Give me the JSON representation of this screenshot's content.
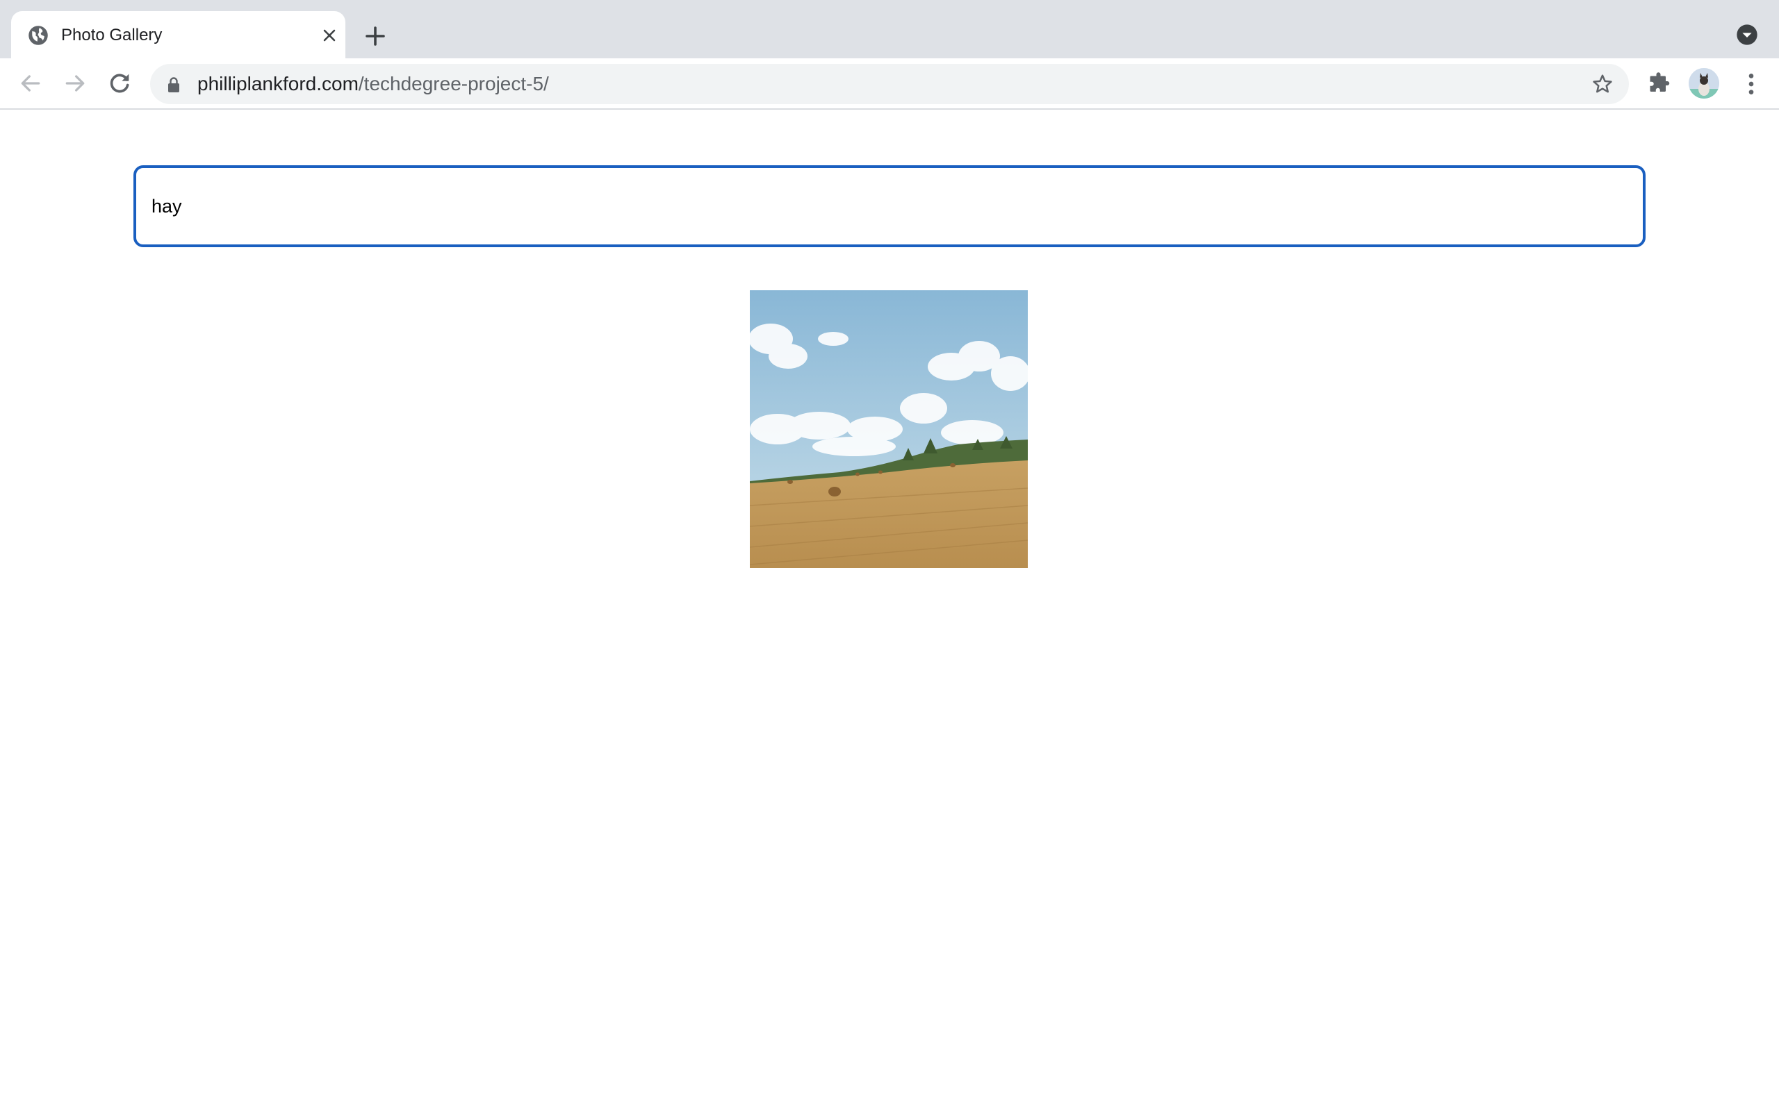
{
  "browser": {
    "tab": {
      "title": "Photo Gallery",
      "favicon": "globe-icon"
    },
    "toolbar": {
      "url_host": "philliplankford.com",
      "url_path": "/techdegree-project-5/",
      "icons": [
        "back-arrow-icon",
        "forward-arrow-icon",
        "reload-icon",
        "lock-icon",
        "star-icon",
        "puzzle-icon",
        "kebab-menu-icon"
      ]
    }
  },
  "page": {
    "search": {
      "value": "hay"
    },
    "gallery": {
      "photos": [
        {
          "subject": "hay-bales-field"
        }
      ]
    }
  },
  "colors": {
    "tabstrip": "#dee1e6",
    "omnibox": "#f1f3f4",
    "focus_ring": "#1a5fc0"
  }
}
